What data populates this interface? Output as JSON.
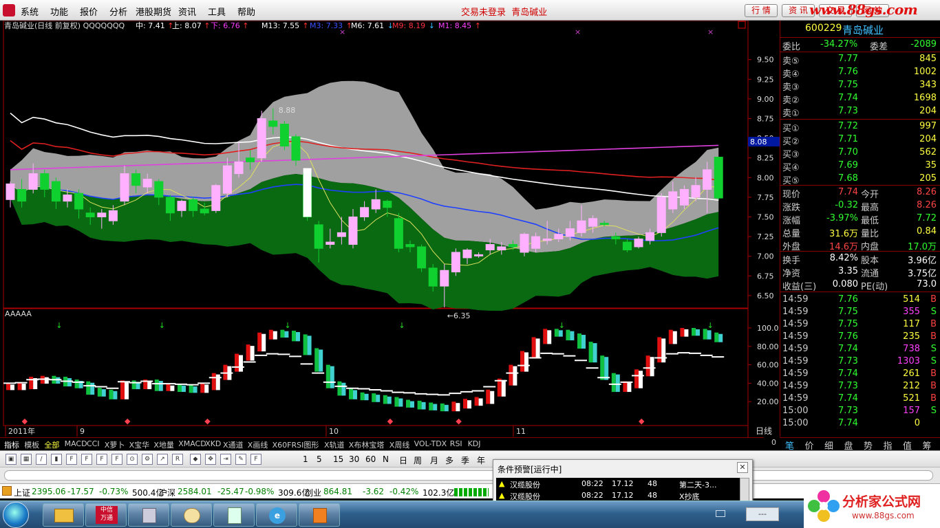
{
  "menu": {
    "items": [
      "系统",
      "功能",
      "报价",
      "分析",
      "港股期货",
      "资讯",
      "工具",
      "帮助"
    ],
    "center_status": "交易未登录",
    "center_name": "青岛碱业",
    "buttons": [
      "行 情",
      "资 讯",
      "交 易",
      "网 站"
    ],
    "logo_text": "www.88gs.com"
  },
  "chart": {
    "title": "青岛碱业(日线 前复权) QQQQQQQ",
    "legend": [
      {
        "label": "中: 7.41",
        "arrow": "↑",
        "color": "#ffffff"
      },
      {
        "label": "上: 8.07",
        "arrow": "↑",
        "color": "#ffffff"
      },
      {
        "label": "下: 6.76",
        "arrow": "↑",
        "color": "#ff3cff"
      },
      {
        "label": "M13: 7.55",
        "arrow": "↑",
        "color": "#ffffff"
      },
      {
        "label": "M3: 7.33",
        "arrow": "↑",
        "color": "#3c50ff"
      },
      {
        "label": "M6: 7.61",
        "arrow": "↓",
        "color": "#ffffff"
      },
      {
        "label": "M9: 8.19",
        "arrow": "↓",
        "color": "#ff3040"
      },
      {
        "label": "M1: 8.45",
        "arrow": "↑",
        "color": "#ff40ff"
      }
    ],
    "price_ticks": [
      "9.50",
      "9.25",
      "9.00",
      "8.75",
      "8.50",
      "8.25",
      "8.00",
      "7.75",
      "7.50",
      "7.25",
      "7.00",
      "6.75",
      "6.50"
    ],
    "current_price_tag": "8.08",
    "high_label": "8.88",
    "low_label": "6.35",
    "indicator_name": "AAAAA",
    "indicator_ticks": [
      "100.0",
      "80.00",
      "60.00",
      "40.00",
      "20.00"
    ],
    "date_labels": [
      "2011年",
      "9",
      "10",
      "11"
    ],
    "period_label": "日线",
    "pager": [
      "+",
      "-",
      "0"
    ]
  },
  "quote": {
    "code": "600229",
    "name": "青岛碱业",
    "weibi_label": "委比",
    "weibi": "-34.27%",
    "weicha_label": "委差",
    "weicha": "-2089",
    "sells": [
      {
        "label": "卖⑤",
        "price": "7.77",
        "vol": "845"
      },
      {
        "label": "卖④",
        "price": "7.76",
        "vol": "1002"
      },
      {
        "label": "卖③",
        "price": "7.75",
        "vol": "343"
      },
      {
        "label": "卖②",
        "price": "7.74",
        "vol": "1698"
      },
      {
        "label": "卖①",
        "price": "7.73",
        "vol": "204"
      }
    ],
    "buys": [
      {
        "label": "买①",
        "price": "7.72",
        "vol": "997"
      },
      {
        "label": "买②",
        "price": "7.71",
        "vol": "204"
      },
      {
        "label": "买③",
        "price": "7.70",
        "vol": "562"
      },
      {
        "label": "买④",
        "price": "7.69",
        "vol": "35"
      },
      {
        "label": "买⑤",
        "price": "7.68",
        "vol": "205"
      }
    ],
    "stats1": [
      {
        "l1": "现价",
        "v1": "7.74",
        "c1": "#ff4444",
        "l2": "今开",
        "v2": "8.26",
        "c2": "#ff4444"
      },
      {
        "l1": "涨跌",
        "v1": "-0.32",
        "c1": "#30ff30",
        "l2": "最高",
        "v2": "8.26",
        "c2": "#ff4444"
      },
      {
        "l1": "涨幅",
        "v1": "-3.97%",
        "c1": "#30ff30",
        "l2": "最低",
        "v2": "7.72",
        "c2": "#30ff30"
      },
      {
        "l1": "总量",
        "v1": "31.6万",
        "c1": "#ffff40",
        "l2": "量比",
        "v2": "0.84",
        "c2": "#ffff40"
      },
      {
        "l1": "外盘",
        "v1": "14.6万",
        "c1": "#ff4444",
        "l2": "内盘",
        "v2": "17.0万",
        "c2": "#30ff30"
      }
    ],
    "stats2": [
      {
        "l1": "换手",
        "v1": "8.42%",
        "l2": "股本",
        "v2": "3.96亿"
      },
      {
        "l1": "净资",
        "v1": "3.35",
        "l2": "流通",
        "v2": "3.75亿"
      },
      {
        "l1": "收益(三)",
        "v1": "0.080",
        "l2": "PE(动)",
        "v2": "73.0"
      }
    ],
    "ticks": [
      {
        "t": "14:59",
        "p": "7.76",
        "v": "514",
        "bs": "B"
      },
      {
        "t": "14:59",
        "p": "7.75",
        "v": "355",
        "bs": "S"
      },
      {
        "t": "14:59",
        "p": "7.75",
        "v": "117",
        "bs": "B"
      },
      {
        "t": "14:59",
        "p": "7.76",
        "v": "235",
        "bs": "B"
      },
      {
        "t": "14:59",
        "p": "7.74",
        "v": "738",
        "bs": "S"
      },
      {
        "t": "14:59",
        "p": "7.73",
        "v": "1303",
        "bs": "S"
      },
      {
        "t": "14:59",
        "p": "7.74",
        "v": "261",
        "bs": "B"
      },
      {
        "t": "14:59",
        "p": "7.73",
        "v": "212",
        "bs": "B"
      },
      {
        "t": "14:59",
        "p": "7.74",
        "v": "521",
        "bs": "B"
      },
      {
        "t": "15:00",
        "p": "7.73",
        "v": "157",
        "bs": "S"
      },
      {
        "t": "15:00",
        "p": "7.74",
        "v": "0",
        "bs": ""
      }
    ],
    "tabs": [
      "笔",
      "价",
      "细",
      "盘",
      "势",
      "指",
      "值",
      "筹"
    ]
  },
  "indicator_tabs": [
    "指标",
    "模板",
    "全部",
    "MACD",
    "CCI",
    "X萝卜",
    "X宝华",
    "X地量",
    "XMACD",
    "XKD",
    "X通道",
    "X画线",
    "X60FRSI图形",
    "X轨道",
    "X布林宝塔",
    "X周线",
    "VOL-TDX",
    "RSI",
    "KDJ"
  ],
  "toolbar": {
    "periods": [
      "1",
      "5",
      "15",
      "30",
      "60",
      "N",
      "日",
      "周",
      "月",
      "多",
      "季",
      "年"
    ]
  },
  "status": {
    "sh_label": "上证",
    "sh_value": "2395.06",
    "sh_chg": "-17.57",
    "sh_pct": "-0.73%",
    "sh_amt": "500.4亿",
    "sz_label": "沪深",
    "sz_value": "2584.01",
    "sz_chg": "-25.47",
    "sz_pct": "-0.98%",
    "sz_amt": "309.6亿",
    "cy_label": "创业",
    "cy_value": "864.81",
    "cy_chg": "-3.62",
    "cy_pct": "-0.42%",
    "cy_amt": "102.3亿"
  },
  "alert": {
    "title": "条件预警[运行中]",
    "rows": [
      {
        "name": "汉缆股份",
        "time": "08:22",
        "price": "17.12",
        "n": "48",
        "desc": "第二天-3..."
      },
      {
        "name": "汉缆股份",
        "time": "08:22",
        "price": "17.12",
        "n": "48",
        "desc": "X抄底"
      }
    ]
  },
  "taskbar": {
    "apps": [
      "explorer",
      "中信万通",
      "calculator",
      "paint",
      "notes",
      "ie",
      "media"
    ],
    "tray_time": "---"
  },
  "brand": {
    "name": "分析家公式网",
    "url": "www.88gs.com"
  },
  "candles": [
    [
      7.72,
      7.92,
      7.62,
      7.95
    ],
    [
      7.85,
      7.7,
      7.62,
      7.98
    ],
    [
      7.85,
      8.05,
      7.8,
      8.18
    ],
    [
      8.05,
      7.85,
      7.75,
      8.1
    ],
    [
      7.95,
      7.7,
      7.6,
      8.0
    ],
    [
      7.7,
      7.78,
      7.62,
      7.85
    ],
    [
      7.8,
      7.6,
      7.48,
      7.85
    ],
    [
      7.55,
      7.5,
      7.4,
      7.62
    ],
    [
      7.5,
      7.55,
      7.35,
      7.6
    ],
    [
      7.45,
      7.58,
      7.4,
      7.65
    ],
    [
      7.7,
      8.05,
      7.65,
      8.15
    ],
    [
      8.05,
      7.9,
      7.8,
      8.1
    ],
    [
      7.88,
      7.98,
      7.8,
      8.05
    ],
    [
      7.95,
      7.75,
      7.65,
      7.98
    ],
    [
      7.75,
      7.55,
      7.45,
      7.78
    ],
    [
      7.58,
      7.7,
      7.5,
      7.72
    ],
    [
      7.72,
      7.58,
      7.5,
      7.75
    ],
    [
      7.6,
      7.55,
      7.52,
      7.68
    ],
    [
      7.58,
      7.9,
      7.55,
      7.92
    ],
    [
      7.8,
      8.15,
      7.75,
      8.25
    ],
    [
      8.05,
      8.2,
      8.0,
      8.45
    ],
    [
      8.25,
      8.2,
      8.1,
      8.35
    ],
    [
      8.25,
      8.75,
      8.2,
      8.85
    ],
    [
      8.72,
      8.65,
      8.55,
      8.88
    ],
    [
      8.68,
      8.4,
      8.35,
      8.72
    ],
    [
      8.52,
      8.22,
      8.15,
      8.55
    ],
    [
      8.05,
      7.5,
      7.45,
      8.1
    ],
    [
      7.4,
      7.1,
      6.92,
      7.45
    ],
    [
      7.15,
      7.18,
      7.1,
      7.35
    ],
    [
      7.25,
      7.3,
      7.15,
      7.5
    ],
    [
      7.15,
      7.5,
      7.1,
      7.6
    ],
    [
      7.5,
      7.62,
      7.45,
      7.7
    ],
    [
      7.6,
      7.72,
      7.55,
      7.85
    ],
    [
      7.7,
      7.62,
      7.5,
      7.72
    ],
    [
      7.48,
      7.1,
      7.05,
      7.55
    ],
    [
      7.15,
      7.12,
      7.05,
      7.2
    ],
    [
      7.12,
      6.85,
      6.8,
      7.15
    ],
    [
      6.85,
      6.62,
      6.55,
      6.9
    ],
    [
      6.62,
      6.82,
      6.35,
      6.9
    ],
    [
      6.8,
      7.05,
      6.75,
      7.1
    ],
    [
      6.98,
      7.08,
      6.9,
      7.1
    ],
    [
      7.02,
      7.02,
      6.98,
      7.05
    ],
    [
      7.08,
      7.15,
      7.02,
      7.22
    ],
    [
      7.08,
      7.12,
      7.02,
      7.18
    ],
    [
      7.15,
      7.12,
      7.08,
      7.2
    ],
    [
      7.05,
      7.28,
      7.0,
      7.3
    ],
    [
      7.1,
      7.25,
      7.05,
      7.3
    ],
    [
      7.2,
      7.22,
      7.15,
      7.45
    ],
    [
      7.22,
      7.28,
      7.18,
      7.35
    ],
    [
      7.25,
      7.35,
      7.2,
      7.45
    ],
    [
      7.3,
      7.45,
      7.25,
      7.65
    ],
    [
      7.38,
      7.48,
      7.3,
      7.52
    ],
    [
      7.42,
      7.41,
      7.38,
      7.45
    ],
    [
      7.25,
      7.22,
      7.15,
      7.3
    ],
    [
      7.18,
      7.08,
      7.05,
      7.22
    ],
    [
      7.12,
      7.22,
      7.1,
      7.25
    ],
    [
      7.2,
      7.3,
      7.15,
      7.35
    ],
    [
      7.3,
      7.75,
      7.25,
      7.8
    ],
    [
      7.6,
      7.82,
      7.55,
      7.95
    ],
    [
      7.65,
      7.85,
      7.6,
      7.9
    ],
    [
      7.75,
      7.9,
      7.7,
      8.0
    ],
    [
      7.85,
      8.1,
      7.55,
      8.2
    ],
    [
      8.26,
      7.74,
      7.72,
      8.26
    ]
  ],
  "indicator_values": [
    40,
    41,
    47,
    48,
    47,
    44,
    42,
    35,
    33,
    30,
    43,
    41,
    44,
    39,
    39,
    38,
    37,
    40,
    51,
    60,
    72,
    82,
    95,
    98,
    97,
    93,
    78,
    60,
    42,
    34,
    30,
    29,
    27,
    25,
    22,
    21,
    19,
    18,
    17,
    20,
    23,
    25,
    33,
    45,
    60,
    75,
    90,
    99,
    98,
    94,
    85,
    70,
    51,
    38,
    42,
    55,
    70,
    90,
    98,
    100,
    99,
    95,
    92
  ]
}
